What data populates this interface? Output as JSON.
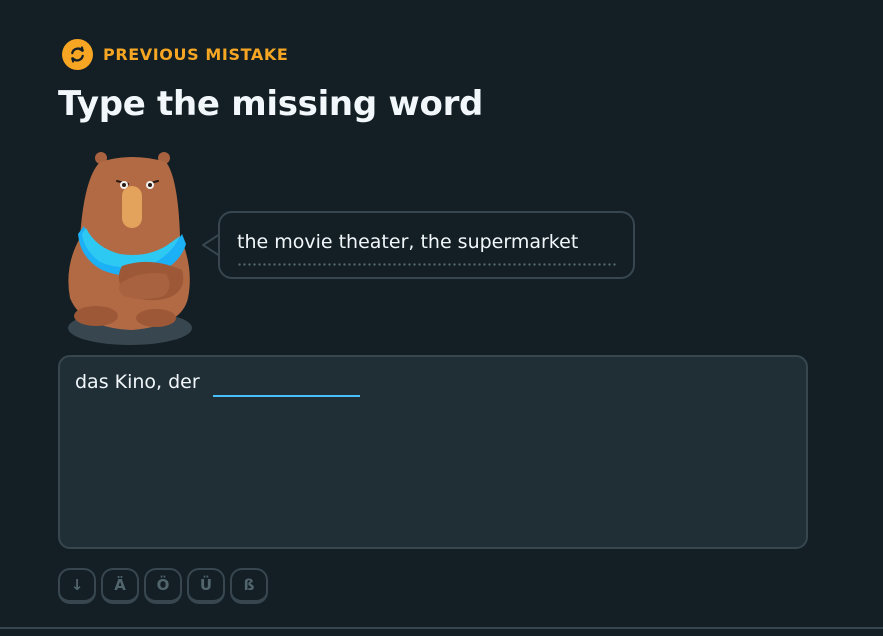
{
  "badge": {
    "icon": "refresh-icon",
    "label": "PREVIOUS MISTAKE",
    "color": "#f6a623"
  },
  "title": "Type the missing word",
  "character": {
    "icon": "bear-character"
  },
  "hint": {
    "text": "the movie theater, the supermarket"
  },
  "prompt": {
    "text": "das Kino, der",
    "answer_value": "",
    "accent": "#49c0f8"
  },
  "special_keys": [
    {
      "label": "↓",
      "name": "collapse-keys-button"
    },
    {
      "label": "Ä",
      "name": "key-a-umlaut"
    },
    {
      "label": "Ö",
      "name": "key-o-umlaut"
    },
    {
      "label": "Ü",
      "name": "key-u-umlaut"
    },
    {
      "label": "ß",
      "name": "key-eszett"
    }
  ]
}
